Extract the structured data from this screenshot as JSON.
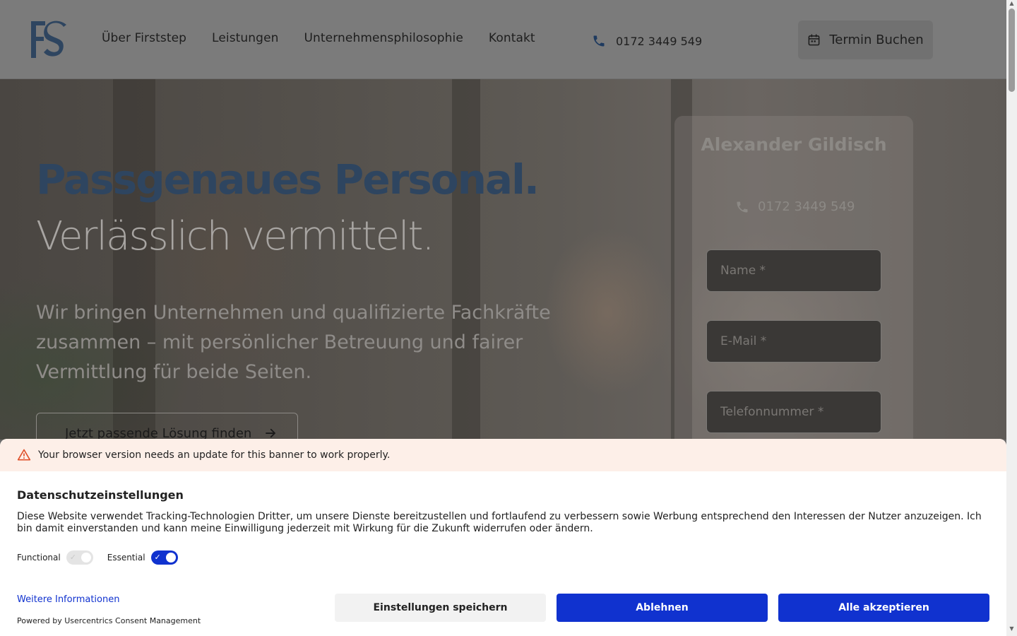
{
  "header": {
    "nav": [
      "Über Firststep",
      "Leistungen",
      "Unternehmensphilosophie",
      "Kontakt"
    ],
    "phone": "0172 3449 549",
    "book_label": "Termin Buchen"
  },
  "hero": {
    "title": "Passgenaues Personal.",
    "subtitle": "Verlässlich vermittelt.",
    "text": "Wir bringen Unternehmen und qualifizierte Fachkräfte zusammen – mit persönlicher Betreuung und fairer Vermittlung für beide Seiten.",
    "cta_label": "Jetzt passende Lösung finden"
  },
  "contact_card": {
    "name": "Alexander Gildisch",
    "phone": "0172 3449 549",
    "fields": {
      "name_placeholder": "Name *",
      "email_placeholder": "E-Mail *",
      "phone_placeholder": "Telefonnummer *"
    }
  },
  "consent": {
    "warning": "Your browser version needs an update for this banner to work properly.",
    "title": "Datenschutzeinstellungen",
    "text": "Diese Website verwendet Tracking-Technologien Dritter, um unsere Dienste bereitzustellen und fortlaufend zu verbessern sowie Werbung entsprechend den Interessen der Nutzer anzuzeigen. Ich bin damit einverstanden und kann meine Einwilligung jederzeit mit Wirkung für die Zukunft widerrufen oder ändern.",
    "toggles": [
      {
        "label": "Functional",
        "on": false
      },
      {
        "label": "Essential",
        "on": true
      }
    ],
    "more_link": "Weitere Informationen",
    "powered_by": "Powered by Usercentrics Consent Management",
    "buttons": {
      "save": "Einstellungen speichern",
      "deny": "Ablehnen",
      "accept": "Alle akzeptieren"
    },
    "colors": {
      "accent": "#1032cf",
      "warning_bg": "#fdefe8"
    }
  }
}
